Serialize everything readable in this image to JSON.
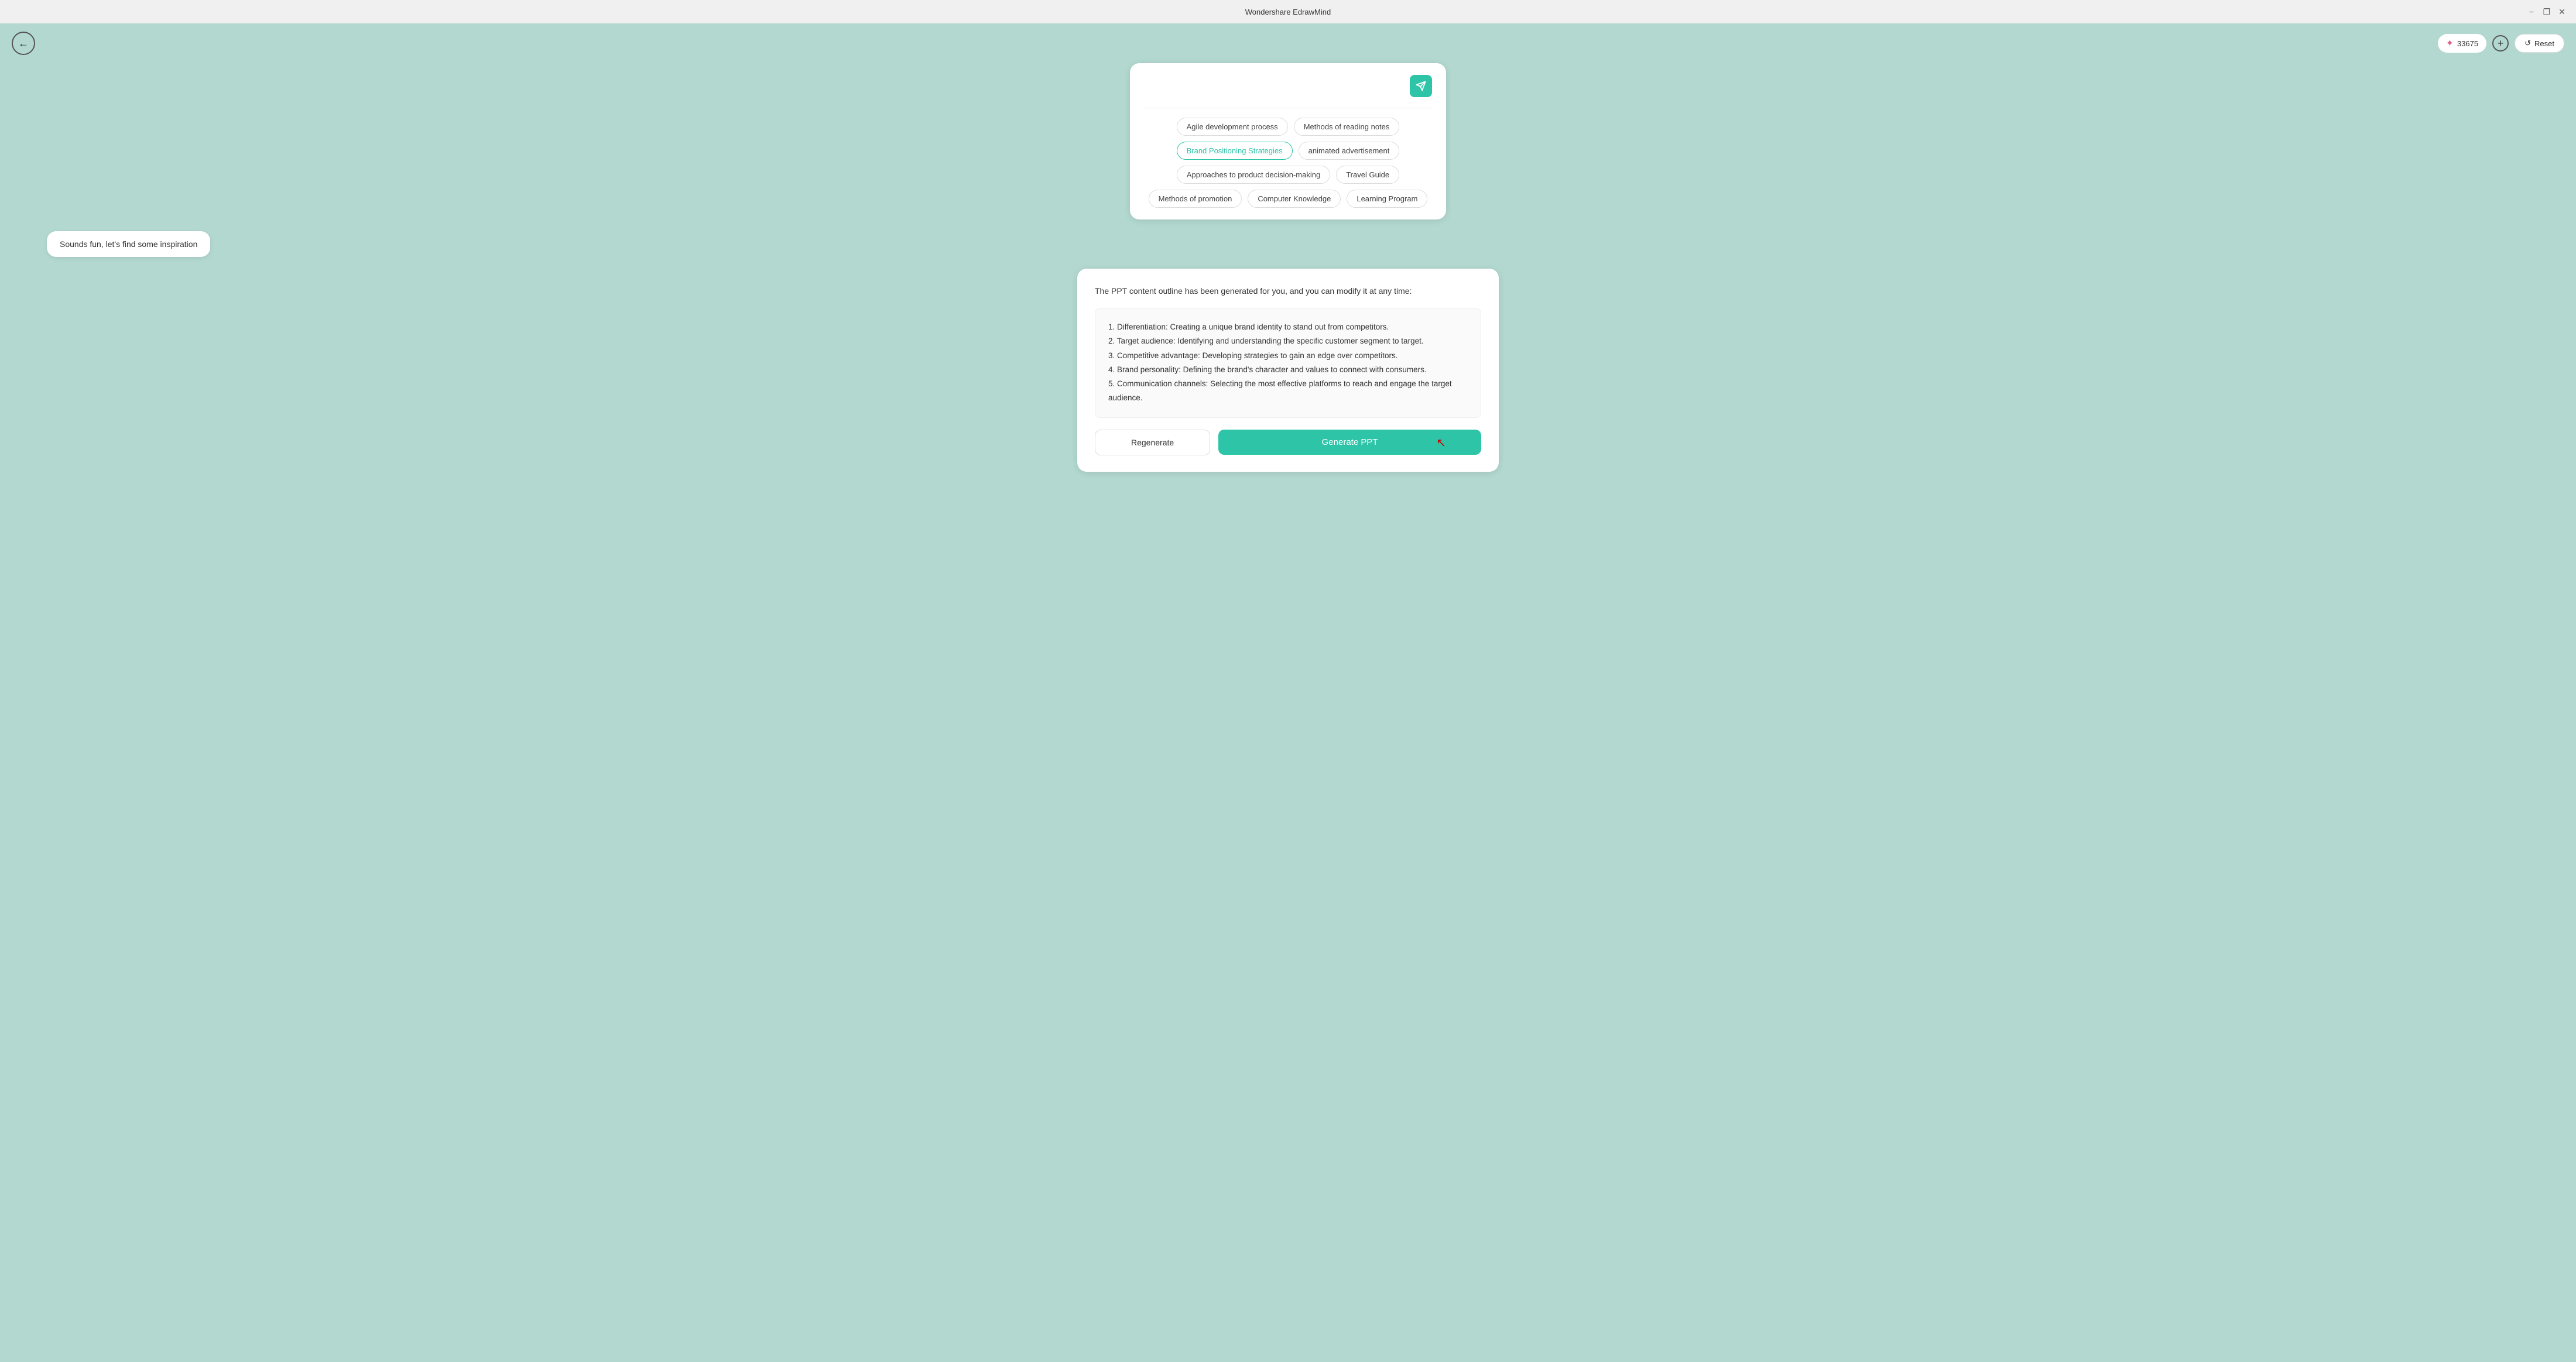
{
  "titleBar": {
    "title": "Wondershare EdrawMind",
    "minimize": "−",
    "maximize": "❐",
    "close": "✕"
  },
  "topBar": {
    "back": "←",
    "credits": "33675",
    "add": "+",
    "reset": "Reset"
  },
  "suggestionCard": {
    "inputPlaceholder": "",
    "inputValue": "",
    "tags": [
      {
        "label": "Agile development process",
        "active": false
      },
      {
        "label": "Methods of reading notes",
        "active": false
      },
      {
        "label": "Brand Positioning Strategies",
        "active": true
      },
      {
        "label": "animated advertisement",
        "active": false
      },
      {
        "label": "Approaches to product decision-making",
        "active": false
      },
      {
        "label": "Travel Guide",
        "active": false
      },
      {
        "label": "Methods of promotion",
        "active": false
      },
      {
        "label": "Computer Knowledge",
        "active": false
      },
      {
        "label": "Learning Program",
        "active": false
      }
    ]
  },
  "inspirationBubble": {
    "text": "Sounds fun, let's find some inspiration"
  },
  "generatedCard": {
    "title": "The PPT content outline has been generated for you, and you can modify it at any time:",
    "outlineItems": [
      "1. Differentiation: Creating a unique brand identity to stand out from competitors.",
      "2. Target audience: Identifying and understanding the specific customer segment to target.",
      "3. Competitive advantage: Developing strategies to gain an edge over competitors.",
      "4. Brand personality: Defining the brand's character and values to connect with consumers.",
      "5. Communication channels: Selecting the most effective platforms to reach and engage the target audience."
    ],
    "regenerateLabel": "Regenerate",
    "generatePPTLabel": "Generate PPT"
  }
}
